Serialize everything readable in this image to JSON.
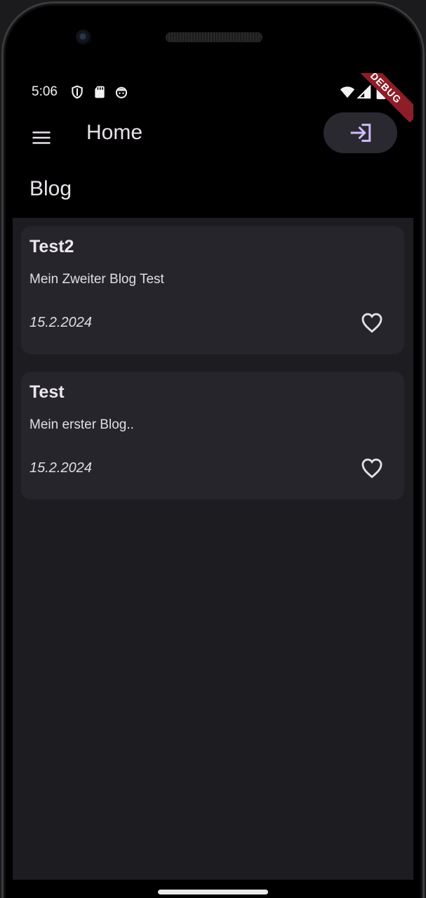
{
  "status_bar": {
    "time": "5:06",
    "icons": [
      "shield-icon",
      "sd-card-icon",
      "android-face-icon",
      "wifi-icon",
      "signal-icon",
      "battery-icon"
    ]
  },
  "app_bar": {
    "title": "Home",
    "menu_icon": "menu-icon",
    "login_icon": "login-icon"
  },
  "debug_banner": {
    "label": "DEBUG"
  },
  "blog": {
    "section_title": "Blog",
    "posts": [
      {
        "title": "Test2",
        "body": "Mein Zweiter Blog Test",
        "date": "15.2.2024",
        "like_icon": "heart-outline-icon"
      },
      {
        "title": "Test",
        "body": "Mein erster Blog..",
        "date": "15.2.2024",
        "like_icon": "heart-outline-icon"
      }
    ]
  },
  "colors": {
    "background": "#1d1c21",
    "card": "#26252b",
    "accent": "#d0bcff",
    "debug_ribbon": "#8d1d28"
  }
}
